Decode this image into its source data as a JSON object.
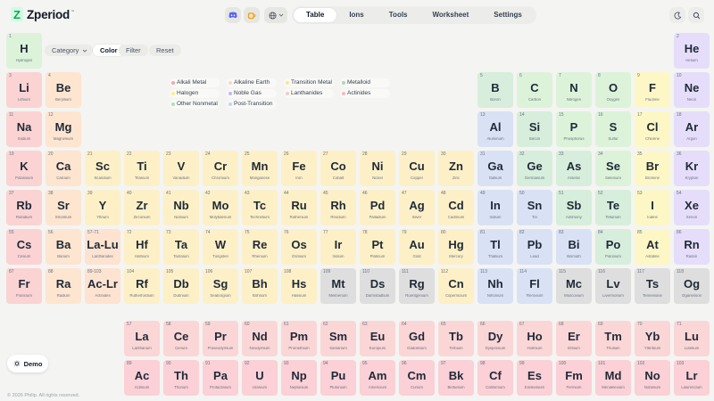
{
  "app": {
    "logo_letter": "Z",
    "name": "Zperiod",
    "trademark": "™"
  },
  "nav": {
    "tabs": [
      "Table",
      "Ions",
      "Tools",
      "Worksheet",
      "Settings"
    ],
    "active": "Table"
  },
  "controls": {
    "category_label": "Category",
    "color_label": "Color",
    "filter_label": "Filter",
    "reset_label": "Reset"
  },
  "legend": [
    {
      "label": "Alkali Metal",
      "color": "#f8a5a5"
    },
    {
      "label": "Alkaline Earth",
      "color": "#fcd9b6"
    },
    {
      "label": "Transition Metal",
      "color": "#fde68a"
    },
    {
      "label": "Metalloid",
      "color": "#a7d9b9"
    },
    {
      "label": "Halogen",
      "color": "#fef08a"
    },
    {
      "label": "Noble Gas",
      "color": "#c4b5fd"
    },
    {
      "label": "Lanthanides",
      "color": "#fbc7c7"
    },
    {
      "label": "Actinides",
      "color": "#f9b7b7"
    },
    {
      "label": "Other Nonmetal",
      "color": "#a7e3b5"
    },
    {
      "label": "Post-Transition",
      "color": "#c7d2fe"
    }
  ],
  "colors": {
    "alkali": "#fbd3d3",
    "alkaline": "#fde5d0",
    "transition": "#fdf0c7",
    "post": "#d9e1f5",
    "metalloid": "#d6eedb",
    "nonmetal": "#dcf3da",
    "halogen": "#fdf7c6",
    "noble": "#e6ddfa",
    "lanth": "#fbd6d6",
    "actin": "#fbd0d6",
    "unknown": "#dedede",
    "placeholder": "#fde3d0"
  },
  "elements": [
    {
      "n": "1",
      "s": "H",
      "name": "Hydrogen",
      "c": "nonmetal",
      "g": 1,
      "p": 1
    },
    {
      "n": "2",
      "s": "He",
      "name": "Helium",
      "c": "noble",
      "g": 18,
      "p": 1
    },
    {
      "n": "3",
      "s": "Li",
      "name": "Lithium",
      "c": "alkali",
      "g": 1,
      "p": 2
    },
    {
      "n": "4",
      "s": "Be",
      "name": "Beryllium",
      "c": "alkaline",
      "g": 2,
      "p": 2
    },
    {
      "n": "5",
      "s": "B",
      "name": "Boron",
      "c": "metalloid",
      "g": 13,
      "p": 2
    },
    {
      "n": "6",
      "s": "C",
      "name": "Carbon",
      "c": "nonmetal",
      "g": 14,
      "p": 2
    },
    {
      "n": "7",
      "s": "N",
      "name": "Nitrogen",
      "c": "nonmetal",
      "g": 15,
      "p": 2
    },
    {
      "n": "8",
      "s": "O",
      "name": "Oxygen",
      "c": "nonmetal",
      "g": 16,
      "p": 2
    },
    {
      "n": "9",
      "s": "F",
      "name": "Fluorine",
      "c": "halogen",
      "g": 17,
      "p": 2
    },
    {
      "n": "10",
      "s": "Ne",
      "name": "Neon",
      "c": "noble",
      "g": 18,
      "p": 2
    },
    {
      "n": "11",
      "s": "Na",
      "name": "Sodium",
      "c": "alkali",
      "g": 1,
      "p": 3
    },
    {
      "n": "12",
      "s": "Mg",
      "name": "Magnesium",
      "c": "alkaline",
      "g": 2,
      "p": 3
    },
    {
      "n": "13",
      "s": "Al",
      "name": "Aluminum",
      "c": "post",
      "g": 13,
      "p": 3
    },
    {
      "n": "14",
      "s": "Si",
      "name": "Silicon",
      "c": "metalloid",
      "g": 14,
      "p": 3
    },
    {
      "n": "15",
      "s": "P",
      "name": "Phosphorus",
      "c": "nonmetal",
      "g": 15,
      "p": 3
    },
    {
      "n": "16",
      "s": "S",
      "name": "Sulfur",
      "c": "nonmetal",
      "g": 16,
      "p": 3
    },
    {
      "n": "17",
      "s": "Cl",
      "name": "Chlorine",
      "c": "halogen",
      "g": 17,
      "p": 3
    },
    {
      "n": "18",
      "s": "Ar",
      "name": "Argon",
      "c": "noble",
      "g": 18,
      "p": 3
    },
    {
      "n": "19",
      "s": "K",
      "name": "Potassium",
      "c": "alkali",
      "g": 1,
      "p": 4
    },
    {
      "n": "20",
      "s": "Ca",
      "name": "Calcium",
      "c": "alkaline",
      "g": 2,
      "p": 4
    },
    {
      "n": "21",
      "s": "Sc",
      "name": "Scandium",
      "c": "transition",
      "g": 3,
      "p": 4
    },
    {
      "n": "22",
      "s": "Ti",
      "name": "Titanium",
      "c": "transition",
      "g": 4,
      "p": 4
    },
    {
      "n": "23",
      "s": "V",
      "name": "Vanadium",
      "c": "transition",
      "g": 5,
      "p": 4
    },
    {
      "n": "24",
      "s": "Cr",
      "name": "Chromium",
      "c": "transition",
      "g": 6,
      "p": 4
    },
    {
      "n": "25",
      "s": "Mn",
      "name": "Manganese",
      "c": "transition",
      "g": 7,
      "p": 4
    },
    {
      "n": "26",
      "s": "Fe",
      "name": "Iron",
      "c": "transition",
      "g": 8,
      "p": 4
    },
    {
      "n": "27",
      "s": "Co",
      "name": "Cobalt",
      "c": "transition",
      "g": 9,
      "p": 4
    },
    {
      "n": "28",
      "s": "Ni",
      "name": "Nickel",
      "c": "transition",
      "g": 10,
      "p": 4
    },
    {
      "n": "29",
      "s": "Cu",
      "name": "Copper",
      "c": "transition",
      "g": 11,
      "p": 4
    },
    {
      "n": "30",
      "s": "Zn",
      "name": "Zinc",
      "c": "transition",
      "g": 12,
      "p": 4
    },
    {
      "n": "31",
      "s": "Ga",
      "name": "Gallium",
      "c": "post",
      "g": 13,
      "p": 4
    },
    {
      "n": "32",
      "s": "Ge",
      "name": "Germanium",
      "c": "metalloid",
      "g": 14,
      "p": 4
    },
    {
      "n": "33",
      "s": "As",
      "name": "Arsenic",
      "c": "metalloid",
      "g": 15,
      "p": 4
    },
    {
      "n": "34",
      "s": "Se",
      "name": "Selenium",
      "c": "nonmetal",
      "g": 16,
      "p": 4
    },
    {
      "n": "35",
      "s": "Br",
      "name": "Bromine",
      "c": "halogen",
      "g": 17,
      "p": 4
    },
    {
      "n": "36",
      "s": "Kr",
      "name": "Krypton",
      "c": "noble",
      "g": 18,
      "p": 4
    },
    {
      "n": "37",
      "s": "Rb",
      "name": "Rubidium",
      "c": "alkali",
      "g": 1,
      "p": 5
    },
    {
      "n": "38",
      "s": "Sr",
      "name": "Strontium",
      "c": "alkaline",
      "g": 2,
      "p": 5
    },
    {
      "n": "39",
      "s": "Y",
      "name": "Yttrium",
      "c": "transition",
      "g": 3,
      "p": 5
    },
    {
      "n": "40",
      "s": "Zr",
      "name": "Zirconium",
      "c": "transition",
      "g": 4,
      "p": 5
    },
    {
      "n": "41",
      "s": "Nb",
      "name": "Niobium",
      "c": "transition",
      "g": 5,
      "p": 5
    },
    {
      "n": "42",
      "s": "Mo",
      "name": "Molybdenum",
      "c": "transition",
      "g": 6,
      "p": 5
    },
    {
      "n": "43",
      "s": "Tc",
      "name": "Technetium",
      "c": "transition",
      "g": 7,
      "p": 5
    },
    {
      "n": "44",
      "s": "Ru",
      "name": "Ruthenium",
      "c": "transition",
      "g": 8,
      "p": 5
    },
    {
      "n": "45",
      "s": "Rh",
      "name": "Rhodium",
      "c": "transition",
      "g": 9,
      "p": 5
    },
    {
      "n": "46",
      "s": "Pd",
      "name": "Palladium",
      "c": "transition",
      "g": 10,
      "p": 5
    },
    {
      "n": "47",
      "s": "Ag",
      "name": "Silver",
      "c": "transition",
      "g": 11,
      "p": 5
    },
    {
      "n": "48",
      "s": "Cd",
      "name": "Cadmium",
      "c": "transition",
      "g": 12,
      "p": 5
    },
    {
      "n": "49",
      "s": "In",
      "name": "Indium",
      "c": "post",
      "g": 13,
      "p": 5
    },
    {
      "n": "50",
      "s": "Sn",
      "name": "Tin",
      "c": "post",
      "g": 14,
      "p": 5
    },
    {
      "n": "51",
      "s": "Sb",
      "name": "Antimony",
      "c": "metalloid",
      "g": 15,
      "p": 5
    },
    {
      "n": "52",
      "s": "Te",
      "name": "Tellurium",
      "c": "metalloid",
      "g": 16,
      "p": 5
    },
    {
      "n": "53",
      "s": "I",
      "name": "Iodine",
      "c": "halogen",
      "g": 17,
      "p": 5
    },
    {
      "n": "54",
      "s": "Xe",
      "name": "Xenon",
      "c": "noble",
      "g": 18,
      "p": 5
    },
    {
      "n": "55",
      "s": "Cs",
      "name": "Cesium",
      "c": "alkali",
      "g": 1,
      "p": 6
    },
    {
      "n": "56",
      "s": "Ba",
      "name": "Barium",
      "c": "alkaline",
      "g": 2,
      "p": 6
    },
    {
      "n": "57-71",
      "s": "La-Lu",
      "name": "Lanthanides",
      "c": "placeholder",
      "g": 3,
      "p": 6
    },
    {
      "n": "72",
      "s": "Hf",
      "name": "Hafnium",
      "c": "transition",
      "g": 4,
      "p": 6
    },
    {
      "n": "73",
      "s": "Ta",
      "name": "Tantalum",
      "c": "transition",
      "g": 5,
      "p": 6
    },
    {
      "n": "74",
      "s": "W",
      "name": "Tungsten",
      "c": "transition",
      "g": 6,
      "p": 6
    },
    {
      "n": "75",
      "s": "Re",
      "name": "Rhenium",
      "c": "transition",
      "g": 7,
      "p": 6
    },
    {
      "n": "76",
      "s": "Os",
      "name": "Osmium",
      "c": "transition",
      "g": 8,
      "p": 6
    },
    {
      "n": "77",
      "s": "Ir",
      "name": "Iridium",
      "c": "transition",
      "g": 9,
      "p": 6
    },
    {
      "n": "78",
      "s": "Pt",
      "name": "Platinum",
      "c": "transition",
      "g": 10,
      "p": 6
    },
    {
      "n": "79",
      "s": "Au",
      "name": "Gold",
      "c": "transition",
      "g": 11,
      "p": 6
    },
    {
      "n": "80",
      "s": "Hg",
      "name": "Mercury",
      "c": "transition",
      "g": 12,
      "p": 6
    },
    {
      "n": "81",
      "s": "Tl",
      "name": "Thallium",
      "c": "post",
      "g": 13,
      "p": 6
    },
    {
      "n": "82",
      "s": "Pb",
      "name": "Lead",
      "c": "post",
      "g": 14,
      "p": 6
    },
    {
      "n": "83",
      "s": "Bi",
      "name": "Bismuth",
      "c": "post",
      "g": 15,
      "p": 6
    },
    {
      "n": "84",
      "s": "Po",
      "name": "Polonium",
      "c": "metalloid",
      "g": 16,
      "p": 6
    },
    {
      "n": "85",
      "s": "At",
      "name": "Astatine",
      "c": "halogen",
      "g": 17,
      "p": 6
    },
    {
      "n": "86",
      "s": "Rn",
      "name": "Radon",
      "c": "noble",
      "g": 18,
      "p": 6
    },
    {
      "n": "87",
      "s": "Fr",
      "name": "Francium",
      "c": "alkali",
      "g": 1,
      "p": 7
    },
    {
      "n": "88",
      "s": "Ra",
      "name": "Radium",
      "c": "alkaline",
      "g": 2,
      "p": 7
    },
    {
      "n": "89-103",
      "s": "Ac-Lr",
      "name": "Actinides",
      "c": "placeholder",
      "g": 3,
      "p": 7
    },
    {
      "n": "104",
      "s": "Rf",
      "name": "Rutherfordium",
      "c": "transition",
      "g": 4,
      "p": 7
    },
    {
      "n": "105",
      "s": "Db",
      "name": "Dubnium",
      "c": "transition",
      "g": 5,
      "p": 7
    },
    {
      "n": "106",
      "s": "Sg",
      "name": "Seaborgium",
      "c": "transition",
      "g": 6,
      "p": 7
    },
    {
      "n": "107",
      "s": "Bh",
      "name": "Bohrium",
      "c": "transition",
      "g": 7,
      "p": 7
    },
    {
      "n": "108",
      "s": "Hs",
      "name": "Hassium",
      "c": "transition",
      "g": 8,
      "p": 7
    },
    {
      "n": "109",
      "s": "Mt",
      "name": "Meitnerium",
      "c": "unknown",
      "g": 9,
      "p": 7
    },
    {
      "n": "110",
      "s": "Ds",
      "name": "Darmstadtium",
      "c": "unknown",
      "g": 10,
      "p": 7
    },
    {
      "n": "111",
      "s": "Rg",
      "name": "Roentgenium",
      "c": "unknown",
      "g": 11,
      "p": 7
    },
    {
      "n": "112",
      "s": "Cn",
      "name": "Copernicium",
      "c": "transition",
      "g": 12,
      "p": 7
    },
    {
      "n": "113",
      "s": "Nh",
      "name": "Nihonium",
      "c": "post",
      "g": 13,
      "p": 7
    },
    {
      "n": "114",
      "s": "Fl",
      "name": "Flerovium",
      "c": "post",
      "g": 14,
      "p": 7
    },
    {
      "n": "115",
      "s": "Mc",
      "name": "Moscovium",
      "c": "unknown",
      "g": 15,
      "p": 7
    },
    {
      "n": "116",
      "s": "Lv",
      "name": "Livermorium",
      "c": "unknown",
      "g": 16,
      "p": 7
    },
    {
      "n": "117",
      "s": "Ts",
      "name": "Tennessine",
      "c": "unknown",
      "g": 17,
      "p": 7
    },
    {
      "n": "118",
      "s": "Og",
      "name": "Oganesson",
      "c": "unknown",
      "g": 18,
      "p": 7
    },
    {
      "n": "57",
      "s": "La",
      "name": "Lanthanum",
      "c": "lanth",
      "g": 4,
      "p": 9
    },
    {
      "n": "58",
      "s": "Ce",
      "name": "Cerium",
      "c": "lanth",
      "g": 5,
      "p": 9
    },
    {
      "n": "59",
      "s": "Pr",
      "name": "Praseodymium",
      "c": "lanth",
      "g": 6,
      "p": 9
    },
    {
      "n": "60",
      "s": "Nd",
      "name": "Neodymium",
      "c": "lanth",
      "g": 7,
      "p": 9
    },
    {
      "n": "61",
      "s": "Pm",
      "name": "Promethium",
      "c": "lanth",
      "g": 8,
      "p": 9
    },
    {
      "n": "62",
      "s": "Sm",
      "name": "Samarium",
      "c": "lanth",
      "g": 9,
      "p": 9
    },
    {
      "n": "63",
      "s": "Eu",
      "name": "Europium",
      "c": "lanth",
      "g": 10,
      "p": 9
    },
    {
      "n": "64",
      "s": "Gd",
      "name": "Gadolinium",
      "c": "lanth",
      "g": 11,
      "p": 9
    },
    {
      "n": "65",
      "s": "Tb",
      "name": "Terbium",
      "c": "lanth",
      "g": 12,
      "p": 9
    },
    {
      "n": "66",
      "s": "Dy",
      "name": "Dysprosium",
      "c": "lanth",
      "g": 13,
      "p": 9
    },
    {
      "n": "67",
      "s": "Ho",
      "name": "Holmium",
      "c": "lanth",
      "g": 14,
      "p": 9
    },
    {
      "n": "68",
      "s": "Er",
      "name": "Erbium",
      "c": "lanth",
      "g": 15,
      "p": 9
    },
    {
      "n": "69",
      "s": "Tm",
      "name": "Thulium",
      "c": "lanth",
      "g": 16,
      "p": 9
    },
    {
      "n": "70",
      "s": "Yb",
      "name": "Ytterbium",
      "c": "lanth",
      "g": 17,
      "p": 9
    },
    {
      "n": "71",
      "s": "Lu",
      "name": "Lutetium",
      "c": "lanth",
      "g": 18,
      "p": 9
    },
    {
      "n": "89",
      "s": "Ac",
      "name": "Actinium",
      "c": "actin",
      "g": 4,
      "p": 10
    },
    {
      "n": "90",
      "s": "Th",
      "name": "Thorium",
      "c": "actin",
      "g": 5,
      "p": 10
    },
    {
      "n": "91",
      "s": "Pa",
      "name": "Protactinium",
      "c": "actin",
      "g": 6,
      "p": 10
    },
    {
      "n": "92",
      "s": "U",
      "name": "Uranium",
      "c": "actin",
      "g": 7,
      "p": 10
    },
    {
      "n": "93",
      "s": "Np",
      "name": "Neptunium",
      "c": "actin",
      "g": 8,
      "p": 10
    },
    {
      "n": "94",
      "s": "Pu",
      "name": "Plutonium",
      "c": "actin",
      "g": 9,
      "p": 10
    },
    {
      "n": "95",
      "s": "Am",
      "name": "Americium",
      "c": "actin",
      "g": 10,
      "p": 10
    },
    {
      "n": "96",
      "s": "Cm",
      "name": "Curium",
      "c": "actin",
      "g": 11,
      "p": 10
    },
    {
      "n": "97",
      "s": "Bk",
      "name": "Berkelium",
      "c": "actin",
      "g": 12,
      "p": 10
    },
    {
      "n": "98",
      "s": "Cf",
      "name": "Californium",
      "c": "actin",
      "g": 13,
      "p": 10
    },
    {
      "n": "99",
      "s": "Es",
      "name": "Einsteinium",
      "c": "actin",
      "g": 14,
      "p": 10
    },
    {
      "n": "100",
      "s": "Fm",
      "name": "Fermium",
      "c": "actin",
      "g": 15,
      "p": 10
    },
    {
      "n": "101",
      "s": "Md",
      "name": "Mendelevium",
      "c": "actin",
      "g": 16,
      "p": 10
    },
    {
      "n": "102",
      "s": "No",
      "name": "Nobelium",
      "c": "actin",
      "g": 17,
      "p": 10
    },
    {
      "n": "103",
      "s": "Lr",
      "name": "Lawrencium",
      "c": "actin",
      "g": 18,
      "p": 10
    }
  ],
  "demo_button": {
    "label": "Demo",
    "icon": "gear-icon"
  },
  "footer": {
    "text": "© 2026 Philip. All rights reserved."
  }
}
